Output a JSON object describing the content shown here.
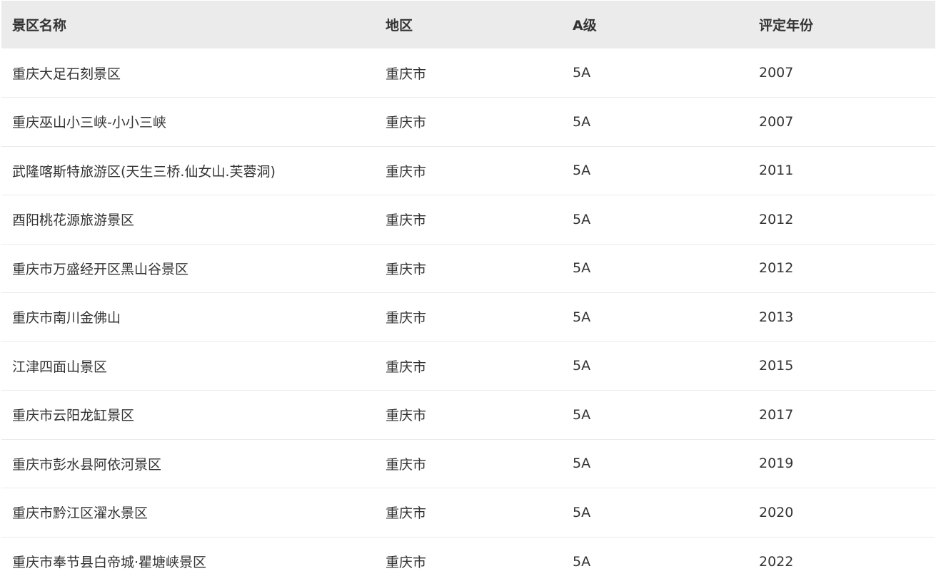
{
  "table": {
    "headers": [
      "景区名称",
      "地区",
      "A级",
      "评定年份"
    ],
    "rows": [
      {
        "name": "重庆大足石刻景区",
        "region": "重庆市",
        "level": "5A",
        "year": "2007"
      },
      {
        "name": "重庆巫山小三峡-小小三峡",
        "region": "重庆市",
        "level": "5A",
        "year": "2007"
      },
      {
        "name": "武隆喀斯特旅游区(天生三桥.仙女山.芙蓉洞)",
        "region": "重庆市",
        "level": "5A",
        "year": "2011"
      },
      {
        "name": "酉阳桃花源旅游景区",
        "region": "重庆市",
        "level": "5A",
        "year": "2012"
      },
      {
        "name": "重庆市万盛经开区黑山谷景区",
        "region": "重庆市",
        "level": "5A",
        "year": "2012"
      },
      {
        "name": "重庆市南川金佛山",
        "region": "重庆市",
        "level": "5A",
        "year": "2013"
      },
      {
        "name": "江津四面山景区",
        "region": "重庆市",
        "level": "5A",
        "year": "2015"
      },
      {
        "name": "重庆市云阳龙缸景区",
        "region": "重庆市",
        "level": "5A",
        "year": "2017"
      },
      {
        "name": "重庆市彭水县阿依河景区",
        "region": "重庆市",
        "level": "5A",
        "year": "2019"
      },
      {
        "name": "重庆市黔江区濯水景区",
        "region": "重庆市",
        "level": "5A",
        "year": "2020"
      },
      {
        "name": "重庆市奉节县白帝城·瞿塘峡景区",
        "region": "重庆市",
        "level": "5A",
        "year": "2022"
      }
    ]
  },
  "colors": {
    "header_bg": "#ebebeb",
    "text": "#333333",
    "row_divider": "#ebebeb"
  }
}
